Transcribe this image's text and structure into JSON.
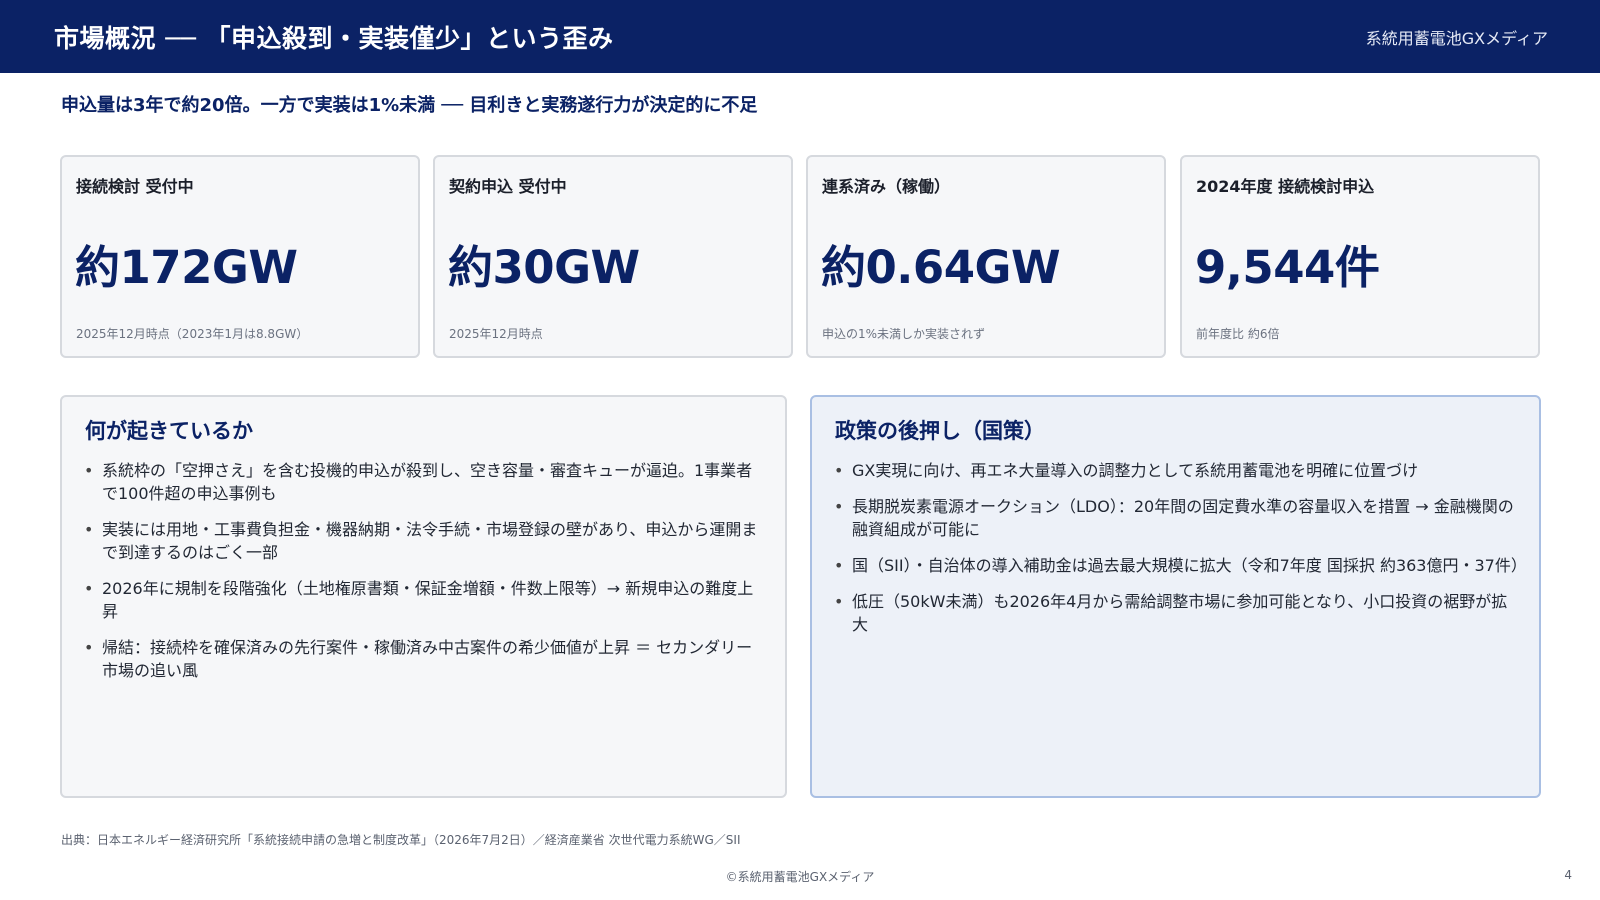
{
  "header": {
    "title": "市場概況 ── 「申込殺到・実装僅少」という歪み",
    "brand": "系統用蓄電池GXメディア"
  },
  "subtitle": "申込量は3年で約20倍。一方で実装は1%未満 ── 目利きと実務遂行力が決定的に不足",
  "kpis": [
    {
      "label": "接続検討 受付中",
      "value": "約172GW",
      "note": "2025年12月時点（2023年1月は8.8GW）"
    },
    {
      "label": "契約申込 受付中",
      "value": "約30GW",
      "note": "2025年12月時点"
    },
    {
      "label": "連系済み（稼働）",
      "value": "約0.64GW",
      "note": "申込の1%未満しか実装されず"
    },
    {
      "label": "2024年度 接続検討申込",
      "value": "9,544件",
      "note": "前年度比 約6倍"
    }
  ],
  "left_panel": {
    "title": "何が起きているか",
    "items": [
      "系統枠の「空押さえ」を含む投機的申込が殺到し、空き容量・審査キューが逼迫。1事業者で100件超の申込事例も",
      "実装には用地・工事費負担金・機器納期・法令手続・市場登録の壁があり、申込から運開まで到達するのはごく一部",
      "2026年に規制を段階強化（土地権原書類・保証金増額・件数上限等）→ 新規申込の難度上昇",
      "帰結：接続枠を確保済みの先行案件・稼働済み中古案件の希少価値が上昇 ＝ セカンダリー市場の追い風"
    ]
  },
  "right_panel": {
    "title": "政策の後押し（国策）",
    "items": [
      "GX実現に向け、再エネ大量導入の調整力として系統用蓄電池を明確に位置づけ",
      "長期脱炭素電源オークション（LDO）：20年間の固定費水準の容量収入を措置 → 金融機関の融資組成が可能に",
      "国（SII）・自治体の導入補助金は過去最大規模に拡大（令和7年度 国採択 約363億円・37件）",
      "低圧（50kW未満）も2026年4月から需給調整市場に参加可能となり、小口投資の裾野が拡大"
    ]
  },
  "source": "出典：日本エネルギー経済研究所「系統接続申請の急増と制度改革」（2026年7月2日）／経済産業省 次世代電力系統WG／SII",
  "footer": "©系統用蓄電池GXメディア",
  "page_number": "4"
}
